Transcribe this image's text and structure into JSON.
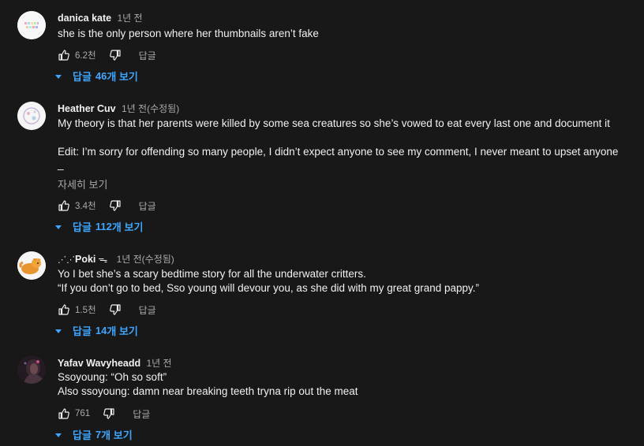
{
  "comments": [
    {
      "author": "danica kate",
      "time": "1년 전",
      "lines": [
        "she is the only person where her thumbnails aren’t fake"
      ],
      "likes": "6.2천",
      "reply_label": "답글",
      "replies_prefix": "답글",
      "replies_count": "46",
      "replies_suffix": "개 보기"
    },
    {
      "author": "Heather Cuv",
      "time": "1년 전(수정됨)",
      "lines": [
        "My theory is that her parents were killed by some sea creatures so she’s vowed to eat every last one and document it",
        "",
        "Edit: I’m sorry for offending so many people, I didn’t expect anyone to see my comment, I never meant to upset anyone",
        "_"
      ],
      "read_more": "자세히 보기",
      "likes": "3.4천",
      "reply_label": "답글",
      "replies_prefix": "답글",
      "replies_count": "112",
      "replies_suffix": "개 보기"
    },
    {
      "author": "Poki",
      "time": "1년 전(수정됨)",
      "lines": [
        "Yo I bet she’s a scary bedtime story for all the underwater critters.",
        "“If you don’t go to bed, Sso young will devour you, as she did with my great grand pappy.”"
      ],
      "likes": "1.5천",
      "reply_label": "답글",
      "replies_prefix": "답글",
      "replies_count": "14",
      "replies_suffix": "개 보기"
    },
    {
      "author": "Yafav Wavyheadd",
      "time": "1년 전",
      "lines": [
        "Ssoyoung: “Oh so soft”",
        "Also ssoyoung: damn near breaking teeth tryna rip out the meat"
      ],
      "likes": "761",
      "reply_label": "답글",
      "replies_prefix": "답글",
      "replies_count": "7",
      "replies_suffix": "개 보기"
    }
  ],
  "colors": {
    "background": "#181818",
    "text": "#f1f1f1",
    "secondary": "#aaaaaa",
    "link": "#3ea6ff"
  },
  "icons": [
    "thumb-up-icon",
    "thumb-down-icon",
    "caret-down-icon"
  ]
}
